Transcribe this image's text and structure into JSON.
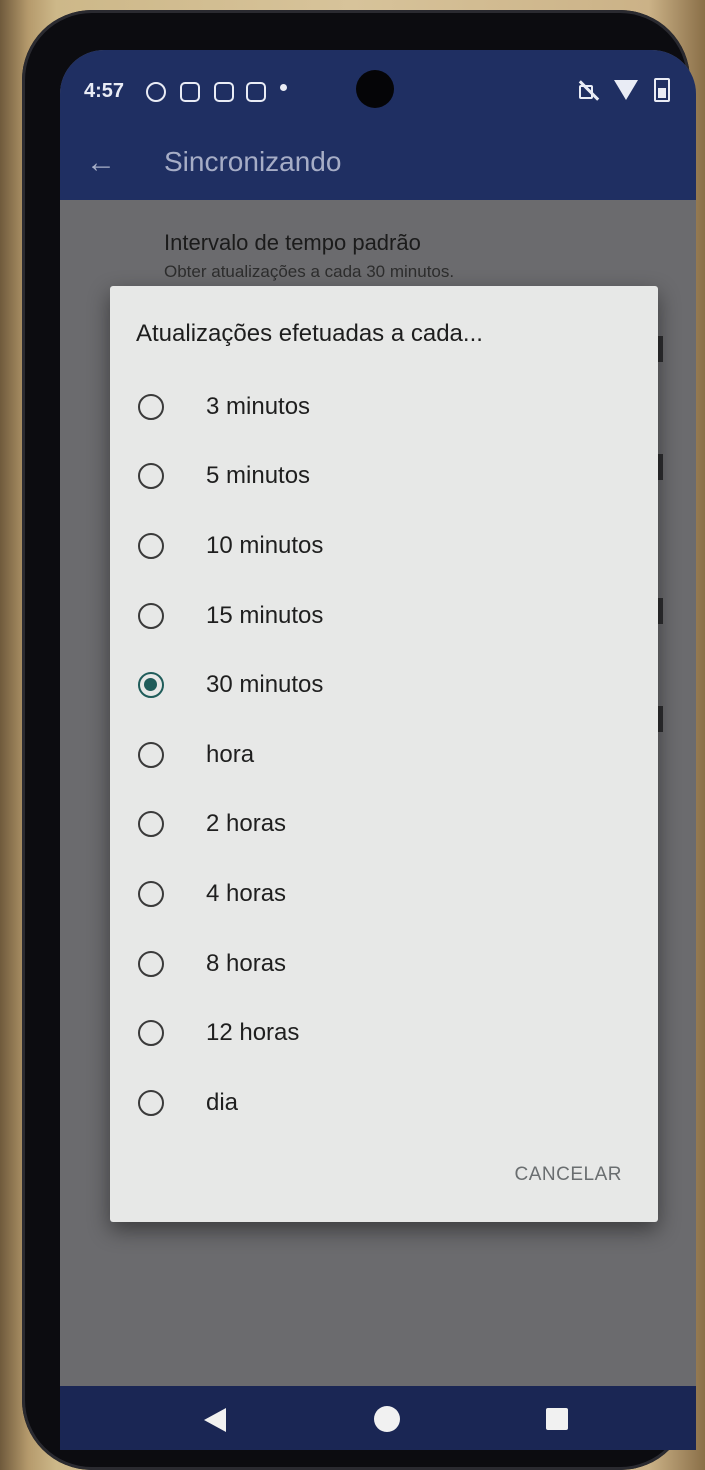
{
  "status_bar": {
    "time": "4:57",
    "icons": [
      "app-notification-icon",
      "sim-icon",
      "bag-icon",
      "message-icon",
      "dot-icon",
      "mute-icon",
      "wifi-icon",
      "battery-icon"
    ]
  },
  "app_bar": {
    "back_icon": "arrow-left-icon",
    "title": "Sincronizando"
  },
  "setting": {
    "title": "Intervalo de tempo padrão",
    "subtitle": "Obter atualizações a cada 30 minutos."
  },
  "dialog": {
    "title": "Atualizações efetuadas a cada...",
    "options": [
      {
        "label": "3 minutos",
        "checked": false
      },
      {
        "label": "5 minutos",
        "checked": false
      },
      {
        "label": "10 minutos",
        "checked": false
      },
      {
        "label": "15 minutos",
        "checked": false
      },
      {
        "label": "30 minutos",
        "checked": true
      },
      {
        "label": "hora",
        "checked": false
      },
      {
        "label": "2 horas",
        "checked": false
      },
      {
        "label": "4 horas",
        "checked": false
      },
      {
        "label": "8 horas",
        "checked": false
      },
      {
        "label": "12 horas",
        "checked": false
      },
      {
        "label": "dia",
        "checked": false
      }
    ],
    "cancel_label": "CANCELAR",
    "accent_color": "#1f5c5a"
  },
  "nav_bar": {
    "icons": [
      "nav-back-icon",
      "nav-home-icon",
      "nav-recents-icon"
    ]
  }
}
